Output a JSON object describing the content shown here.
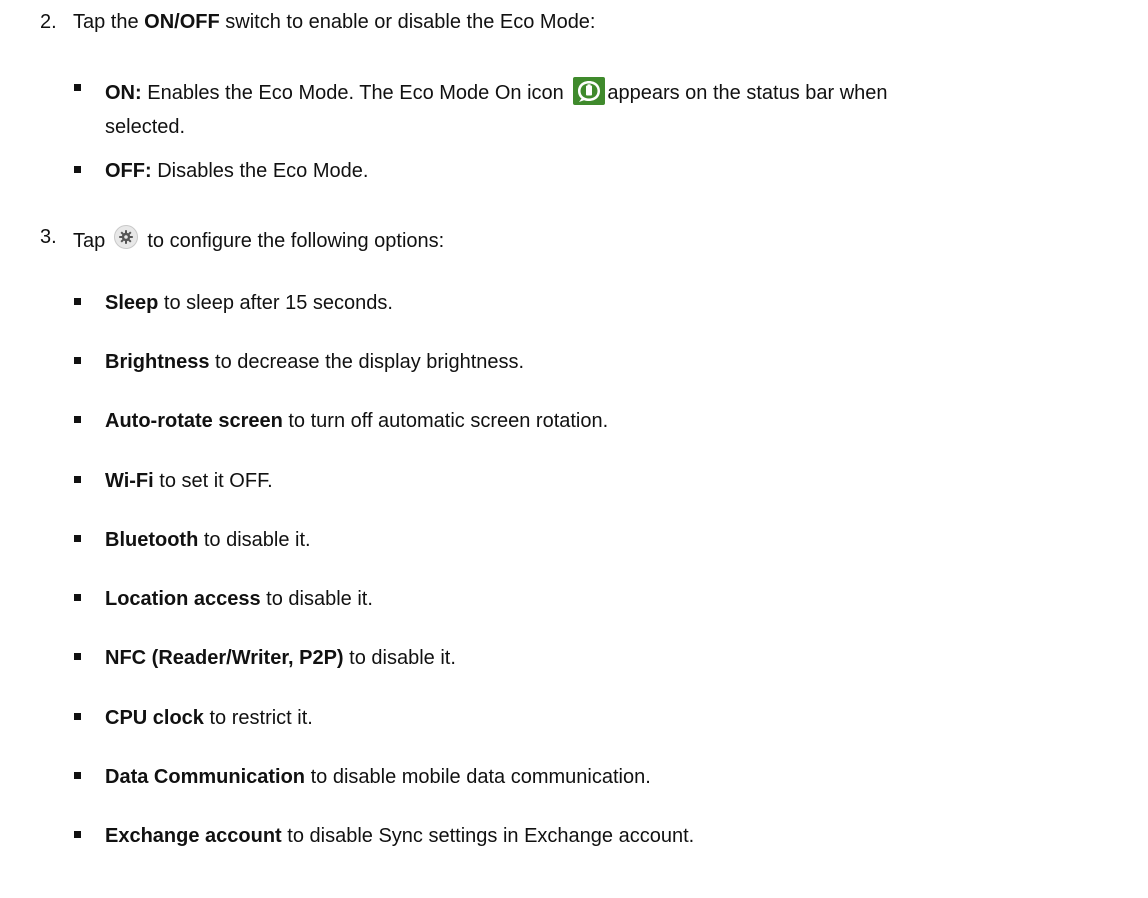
{
  "step2": {
    "number": "2.",
    "prefix": "Tap the ",
    "bold": "ON/OFF",
    "suffix": " switch to enable or disable the Eco Mode:",
    "bullets": [
      {
        "bold": "ON:",
        "text_before_icon": " Enables the Eco Mode. The Eco Mode On icon",
        "text_after_icon": "appears on the status bar when",
        "continuation": "selected."
      },
      {
        "bold": "OFF:",
        "text": " Disables the Eco Mode."
      }
    ]
  },
  "step3": {
    "number": "3.",
    "prefix": "Tap",
    "suffix": "to configure the following options:",
    "bullets": [
      {
        "bold": "Sleep",
        "text": " to sleep after 15 seconds."
      },
      {
        "bold": "Brightness",
        "text": " to decrease the display brightness."
      },
      {
        "bold": "Auto-rotate screen",
        "text": " to turn off automatic screen rotation."
      },
      {
        "bold": "Wi-Fi",
        "text": " to set it OFF."
      },
      {
        "bold": "Bluetooth",
        "text": " to disable it."
      },
      {
        "bold": "Location access",
        "text": " to disable it."
      },
      {
        "bold": "NFC (Reader/Writer, P2P)",
        "text": " to disable it."
      },
      {
        "bold": "CPU clock",
        "text": " to restrict it."
      },
      {
        "bold": "Data Communication",
        "text": " to disable mobile data communication."
      },
      {
        "bold": "Exchange account",
        "text": " to disable Sync settings in Exchange account."
      }
    ]
  },
  "icons": {
    "eco_mode": "eco-mode-on-icon",
    "settings": "gear-icon"
  },
  "colors": {
    "eco_green": "#3f8a2c",
    "gear_gray": "#9e9e9e"
  }
}
